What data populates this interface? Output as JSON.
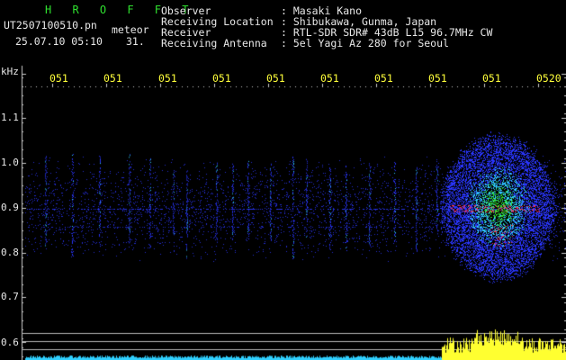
{
  "header": {
    "program": "H R O F F T",
    "filename": "UT2507100510.pn",
    "type": "meteor",
    "datetime": "25.07.10 05:10",
    "extra": "31.",
    "fields": [
      {
        "label": "Observer",
        "value": ": Masaki Kano"
      },
      {
        "label": "Receiving Location",
        "value": ": Shibukawa, Gunma, Japan"
      },
      {
        "label": "Receiver",
        "value": ": RTL-SDR SDR# 43dB L15 96.7MHz CW"
      },
      {
        "label": "Receiving Antenna",
        "value": ": 5el Yagi Az 280 for Seoul"
      }
    ]
  },
  "axes": {
    "y_unit": "kHz",
    "y_ticks": [
      "1.1",
      "1.0",
      "0.9",
      "0.8",
      "0.7",
      "0.6"
    ],
    "x_ticks": [
      "051",
      "051",
      "051",
      "051",
      "051",
      "051",
      "051",
      "051",
      "051",
      "0520"
    ]
  },
  "colors": {
    "background": "#000000",
    "label_white": "#e8e8e8",
    "label_yellow": "#ffff3a",
    "program_green": "#2fe02f",
    "signal_blue": "#2a36ff",
    "signal_cyan": "#30d0ff",
    "signal_green": "#30e030",
    "signal_red": "#ff3050",
    "level_yellow": "#ffff30"
  }
}
